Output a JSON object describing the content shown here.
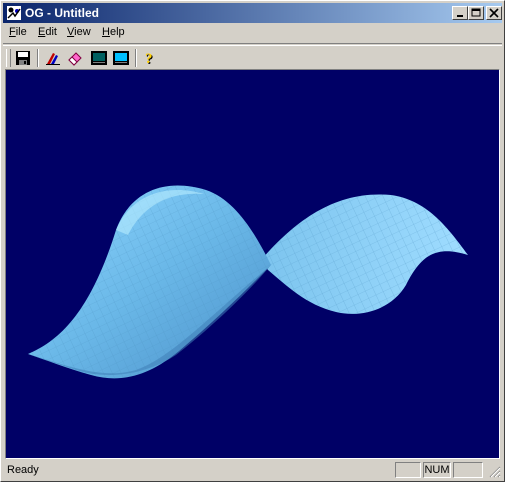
{
  "window": {
    "title": "OG - Untitled"
  },
  "menu": {
    "items": [
      {
        "label": "File",
        "underline": "F",
        "rest": "ile"
      },
      {
        "label": "Edit",
        "underline": "E",
        "rest": "dit"
      },
      {
        "label": "View",
        "underline": "V",
        "rest": "iew"
      },
      {
        "label": "Help",
        "underline": "H",
        "rest": "elp"
      }
    ]
  },
  "toolbar": {
    "icons": [
      "save-icon",
      "color-icon",
      "eraser-icon",
      "wireframe-view-icon",
      "solid-view-icon",
      "help-icon"
    ]
  },
  "status": {
    "text": "Ready",
    "panels": [
      "",
      "NUM",
      ""
    ]
  },
  "colors": {
    "client_bg": "#000066",
    "surface": "#7fc8f0",
    "title_start": "#0a246a",
    "title_end": "#a6caf0"
  }
}
